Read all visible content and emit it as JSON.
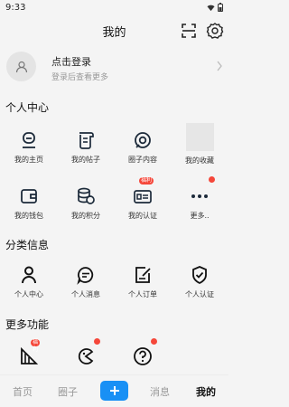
{
  "status": {
    "time": "9:33"
  },
  "header": {
    "title": "我的"
  },
  "login": {
    "title": "点击登录",
    "subtitle": "登录后查看更多"
  },
  "sections": {
    "personal": "个人中心",
    "category": "分类信息",
    "more": "更多功能"
  },
  "personal_items": [
    {
      "label": "我的主页",
      "icon": "robot-face-icon"
    },
    {
      "label": "我的帖子",
      "icon": "scroll-icon"
    },
    {
      "label": "圈子内容",
      "icon": "target-circle-icon"
    },
    {
      "label": "我的收藏",
      "icon": "image-placeholder"
    },
    {
      "label": "我的钱包",
      "icon": "wallet-icon"
    },
    {
      "label": "我的积分",
      "icon": "coins-icon"
    },
    {
      "label": "我的认证",
      "icon": "id-card-icon",
      "badge": "福利"
    },
    {
      "label": "更多..",
      "icon": "more-dots-icon"
    }
  ],
  "category_items": [
    {
      "label": "个人中心",
      "icon": "person-icon"
    },
    {
      "label": "个人消息",
      "icon": "message-icon"
    },
    {
      "label": "个人订单",
      "icon": "order-icon"
    },
    {
      "label": "个人认证",
      "icon": "shield-check-icon"
    }
  ],
  "more_items": [
    {
      "icon": "ruler-icon",
      "badge": "福利"
    },
    {
      "icon": "pacman-icon"
    },
    {
      "icon": "help-icon"
    }
  ],
  "bottom_nav": {
    "home": "首页",
    "circle": "圈子",
    "messages": "消息",
    "mine": "我的"
  },
  "colors": {
    "accent": "#1890f5",
    "red": "#f5473a"
  }
}
